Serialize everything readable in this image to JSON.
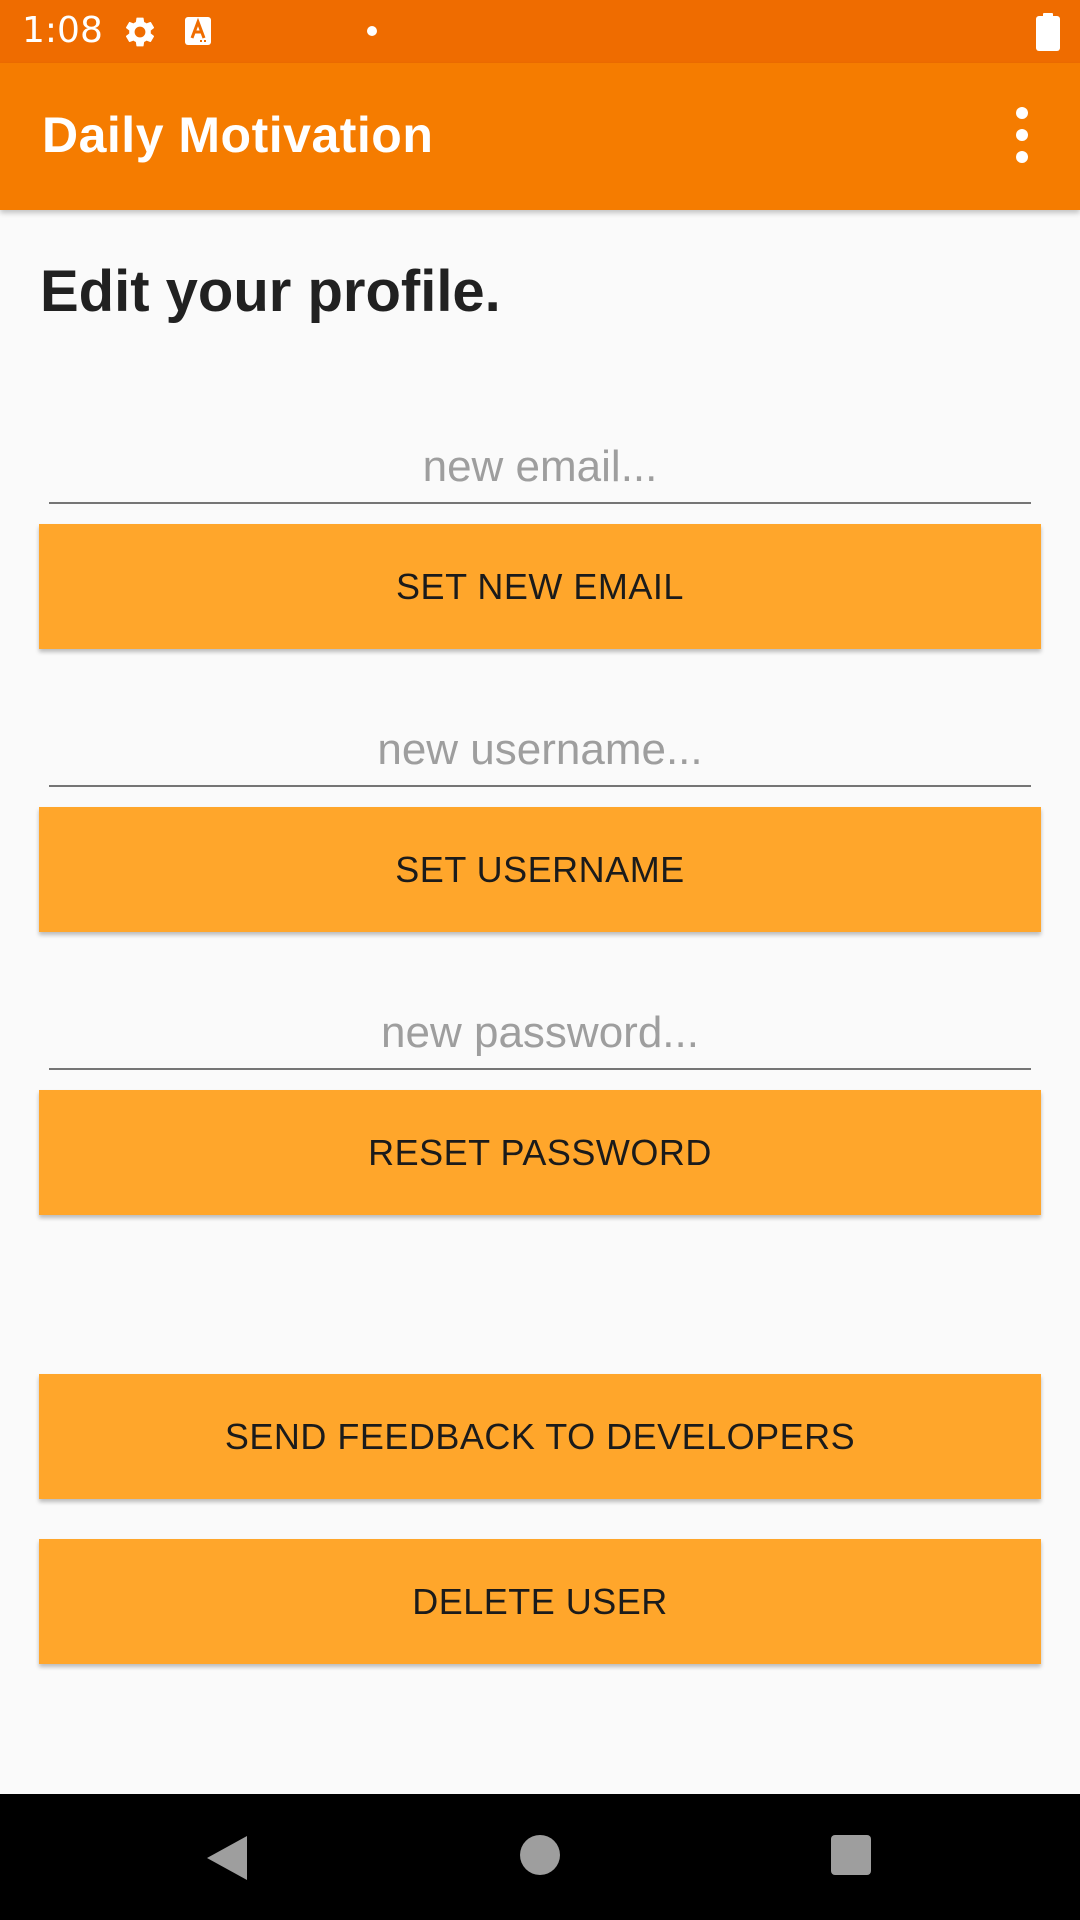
{
  "status_bar": {
    "time": "1:08",
    "icons": [
      "gear-icon",
      "a-notification-icon",
      "dot-icon",
      "battery-icon"
    ]
  },
  "app_bar": {
    "title": "Daily Motivation",
    "overflow_icon": "more-vert-icon",
    "color": "#f57c00"
  },
  "page": {
    "heading": "Edit your profile."
  },
  "form": {
    "email_placeholder": "new email...",
    "email_value": "",
    "set_email_label": "SET NEW EMAIL",
    "username_placeholder": "new username...",
    "username_value": "",
    "set_username_label": "SET USERNAME",
    "password_placeholder": "new password...",
    "password_value": "",
    "reset_password_label": "RESET PASSWORD"
  },
  "actions": {
    "feedback_label": "SEND FEEDBACK TO DEVELOPERS",
    "delete_label": "DELETE USER"
  },
  "nav_bar": {
    "icons": [
      "back-icon",
      "home-icon",
      "recents-icon"
    ]
  },
  "colors": {
    "status_bar": "#ef6c00",
    "app_bar": "#f57c00",
    "button": "#ffa62b",
    "background": "#fafafa"
  }
}
